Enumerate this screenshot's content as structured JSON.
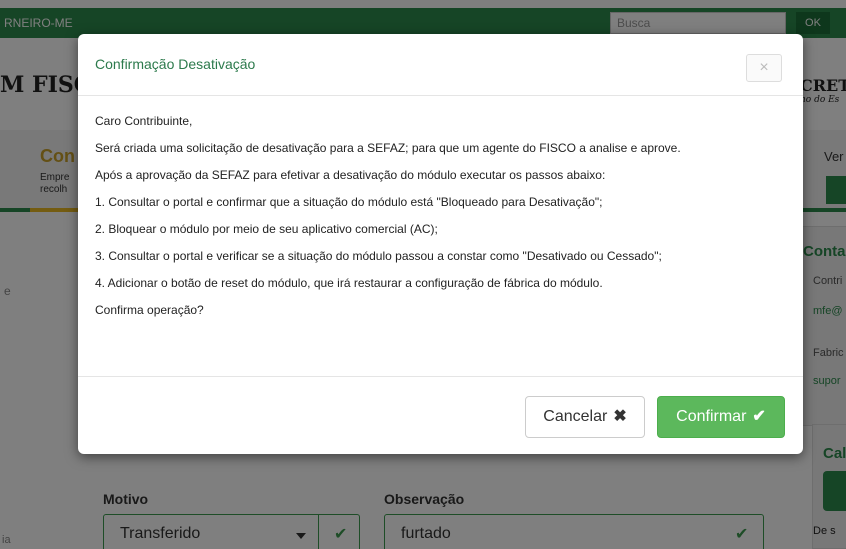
{
  "background": {
    "topbar": {
      "user_text": "RNEIRO-ME",
      "search_placeholder": "Busca",
      "ok_label": "OK"
    },
    "brand_left": "M FISC",
    "brand_right": "CRET",
    "brand_right_sub": "no do Es",
    "banner": {
      "title": "Con",
      "line1": "Empre",
      "line2": "recolh",
      "right_text": "Ver"
    },
    "side_contact": {
      "title": "Conta",
      "line1": "Contri",
      "email": "mfe@",
      "line3": "Fabric",
      "support": "supor"
    },
    "side_call": {
      "title": "Cal",
      "line1": "De s"
    },
    "left_fragment_1": "e",
    "left_fragment_2": "ia",
    "form": {
      "motivo_label": "Motivo",
      "motivo_value": "Transferido",
      "obs_label": "Observação",
      "obs_value": "furtado"
    }
  },
  "modal": {
    "title": "Confirmação Desativação",
    "close_label": "×",
    "body": [
      "Caro Contribuinte,",
      "Será criada uma solicitação de desativação para a SEFAZ; para que um agente do FISCO a analise e aprove.",
      "Após a aprovação da SEFAZ para efetivar a desativação do módulo executar os passos abaixo:",
      "1. Consultar o portal e confirmar que a situação do módulo está \"Bloqueado para Desativação\";",
      "2. Bloquear o módulo por meio de seu aplicativo comercial (AC);",
      "3. Consultar o portal e verificar se a situação do módulo passou a constar como \"Desativado ou Cessado\";",
      "4. Adicionar o botão de reset do módulo, que irá restaurar a configuração de fábrica do módulo.",
      "Confirma operação?"
    ],
    "cancel_label": "Cancelar",
    "cancel_icon": "✖",
    "confirm_label": "Confirmar",
    "confirm_icon": "✔"
  },
  "colors": {
    "accent": "#2c8a4c",
    "confirm": "#5cb85c",
    "title": "#2c7a4c"
  }
}
